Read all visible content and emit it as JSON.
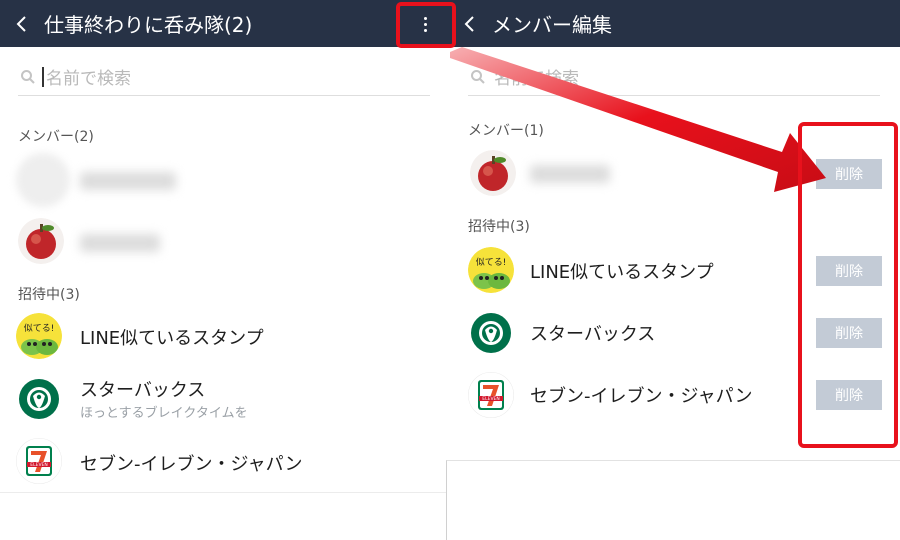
{
  "left": {
    "header_title": "仕事終わりに呑み隊(2)",
    "search_placeholder": "名前で検索",
    "members_label": "メンバー(2)",
    "invited_label": "招待中(3)",
    "invited": [
      {
        "name": "LINE似ているスタンプ",
        "avatar": "stamp-avatar"
      },
      {
        "name": "スターバックス",
        "subtitle": "ほっとするブレイクタイムを",
        "avatar": "starbucks-avatar"
      },
      {
        "name": "セブン-イレブン・ジャパン",
        "avatar": "seven-eleven-avatar"
      }
    ]
  },
  "right": {
    "header_title": "メンバー編集",
    "search_placeholder": "名前で検索",
    "members_label": "メンバー(1)",
    "invited_label": "招待中(3)",
    "delete_label": "削除",
    "invited": [
      {
        "name": "LINE似ているスタンプ"
      },
      {
        "name": "スターバックス"
      },
      {
        "name": "セブン-イレブン・ジャパン"
      }
    ]
  },
  "stamp_text": "似てる!",
  "seven_eleven_text": "ELEVEN",
  "colors": {
    "header": "#273246",
    "highlight": "#e8111c",
    "delete_button": "#c3cbd6",
    "starbucks_green": "#00704a"
  }
}
